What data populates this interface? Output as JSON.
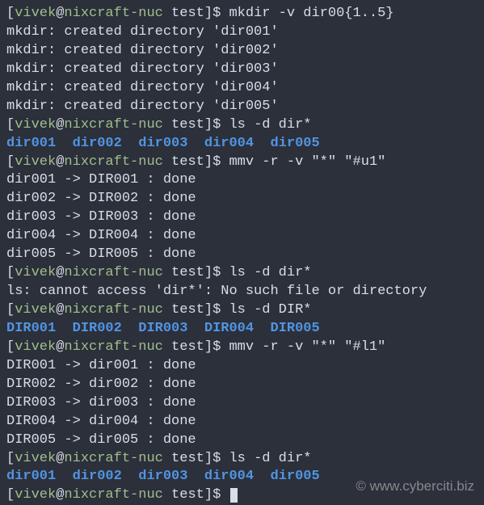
{
  "prompt": {
    "user": "vivek",
    "at": "@",
    "host": "nixcraft-nuc",
    "path": " test",
    "open": "[",
    "close": "]",
    "symbol": "$ "
  },
  "commands": {
    "mkdir": "mkdir -v dir00{1..5}",
    "ls_dir_lower1": "ls -d dir*",
    "mmv_upper": "mmv -r -v \"*\" \"#u1\"",
    "ls_dir_lower2": "ls -d dir*",
    "ls_dir_upper": "ls -d DIR*",
    "mmv_lower": "mmv -r -v \"*\" \"#l1\"",
    "ls_dir_lower3": "ls -d dir*",
    "final": ""
  },
  "mkdir_out": [
    "mkdir: created directory 'dir001'",
    "mkdir: created directory 'dir002'",
    "mkdir: created directory 'dir003'",
    "mkdir: created directory 'dir004'",
    "mkdir: created directory 'dir005'"
  ],
  "dirs_lower": [
    "dir001",
    "dir002",
    "dir003",
    "dir004",
    "dir005"
  ],
  "dirs_upper": [
    "DIR001",
    "DIR002",
    "DIR003",
    "DIR004",
    "DIR005"
  ],
  "mmv_upper_out": [
    "dir001 -> DIR001 : done",
    "dir002 -> DIR002 : done",
    "dir003 -> DIR003 : done",
    "dir004 -> DIR004 : done",
    "dir005 -> DIR005 : done"
  ],
  "ls_error": "ls: cannot access 'dir*': No such file or directory",
  "mmv_lower_out": [
    "DIR001 -> dir001 : done",
    "DIR002 -> dir002 : done",
    "DIR003 -> dir003 : done",
    "DIR004 -> dir004 : done",
    "DIR005 -> dir005 : done"
  ],
  "watermark": "© www.cyberciti.biz",
  "sep": "  "
}
